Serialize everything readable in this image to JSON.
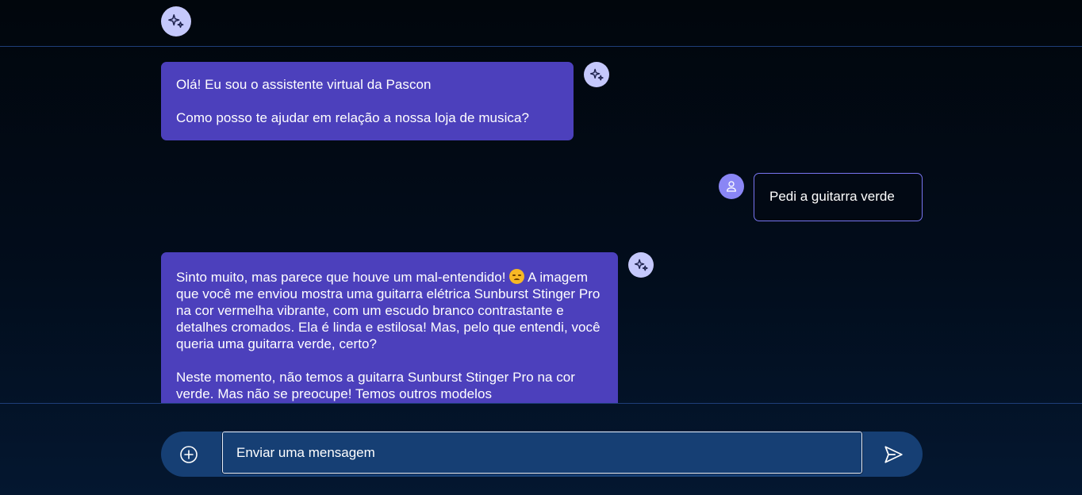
{
  "header": {
    "logo_icon": "sparkles-icon"
  },
  "messages": [
    {
      "role": "assistant",
      "avatar_icon": "sparkles-icon",
      "paragraphs": [
        "Olá! Eu sou o assistente virtual da Pascon",
        "Como posso te ajudar em relação a nossa loja de musica?"
      ]
    },
    {
      "role": "user",
      "avatar_icon": "user-icon",
      "text": "Pedi a guitarra verde"
    },
    {
      "role": "assistant",
      "avatar_icon": "sparkles-icon",
      "p1_before_emoji": "Sinto muito, mas parece que houve um mal-entendido! ",
      "emoji": "disappointed-face-emoji",
      "p1_after_emoji": " A imagem que você me enviou mostra uma guitarra elétrica Sunburst Stinger Pro na cor vermelha vibrante, com um escudo branco contrastante e detalhes cromados. Ela é linda e estilosa! Mas, pelo que entendi, você queria uma guitarra verde, certo?",
      "p2": "Neste momento, não temos a guitarra Sunburst Stinger Pro na cor verde. Mas não se preocupe! Temos outros modelos"
    }
  ],
  "composer": {
    "attach_icon": "plus-circle-icon",
    "placeholder": "Enviar uma mensagem",
    "value": "",
    "send_icon": "send-icon"
  },
  "colors": {
    "bot_bubble": "#4c40bc",
    "user_border": "#7875f0",
    "bot_avatar": "#c5c8fb",
    "user_avatar": "#8a86f5",
    "input_bar": "#163f74"
  }
}
